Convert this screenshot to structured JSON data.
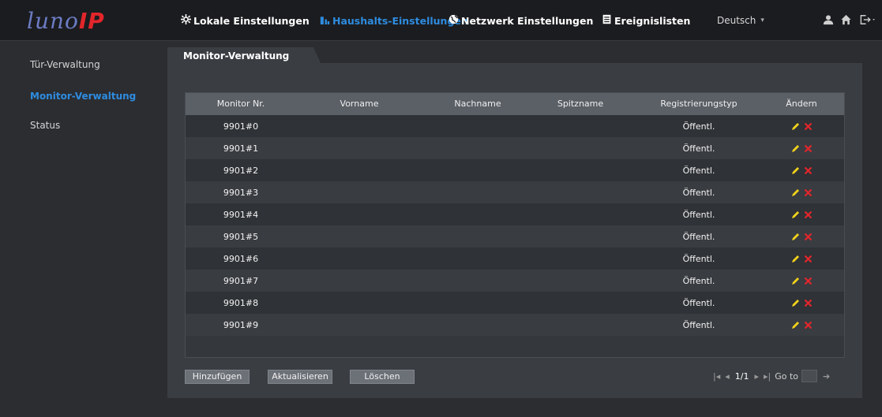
{
  "header": {
    "logo_part1": "luno",
    "logo_part2": "IP",
    "nav": [
      {
        "label": "Lokale Einstellungen",
        "icon": "gear-icon"
      },
      {
        "label": "Haushalts-Einstellungen",
        "icon": "building-icon"
      },
      {
        "label": "Netzwerk Einstellungen",
        "icon": "globe-icon"
      },
      {
        "label": "Ereignislisten",
        "icon": "list-icon"
      }
    ],
    "language": "Deutsch",
    "icons": [
      "user-icon",
      "home-icon",
      "logout-icon"
    ]
  },
  "sidebar": {
    "items": [
      {
        "label": "Tür-Verwaltung"
      },
      {
        "label": "Monitor-Verwaltung"
      },
      {
        "label": "Status"
      }
    ]
  },
  "main": {
    "tab_label": "Monitor-Verwaltung",
    "columns": [
      "Monitor Nr.",
      "Vorname",
      "Nachname",
      "Spitzname",
      "Registrierungstyp",
      "Ändern"
    ],
    "rows": [
      {
        "monitor": "9901#0",
        "vorname": "",
        "nachname": "",
        "spitzname": "",
        "typ": "Öffentl."
      },
      {
        "monitor": "9901#1",
        "vorname": "",
        "nachname": "",
        "spitzname": "",
        "typ": "Öffentl."
      },
      {
        "monitor": "9901#2",
        "vorname": "",
        "nachname": "",
        "spitzname": "",
        "typ": "Öffentl."
      },
      {
        "monitor": "9901#3",
        "vorname": "",
        "nachname": "",
        "spitzname": "",
        "typ": "Öffentl."
      },
      {
        "monitor": "9901#4",
        "vorname": "",
        "nachname": "",
        "spitzname": "",
        "typ": "Öffentl."
      },
      {
        "monitor": "9901#5",
        "vorname": "",
        "nachname": "",
        "spitzname": "",
        "typ": "Öffentl."
      },
      {
        "monitor": "9901#6",
        "vorname": "",
        "nachname": "",
        "spitzname": "",
        "typ": "Öffentl."
      },
      {
        "monitor": "9901#7",
        "vorname": "",
        "nachname": "",
        "spitzname": "",
        "typ": "Öffentl."
      },
      {
        "monitor": "9901#8",
        "vorname": "",
        "nachname": "",
        "spitzname": "",
        "typ": "Öffentl."
      },
      {
        "monitor": "9901#9",
        "vorname": "",
        "nachname": "",
        "spitzname": "",
        "typ": "Öffentl."
      }
    ],
    "buttons": {
      "add": "Hinzufügen",
      "refresh": "Aktualisieren",
      "delete": "Löschen"
    },
    "pager": {
      "page": "1/1",
      "goto_label": "Go to",
      "goto_value": ""
    }
  },
  "colors": {
    "accent": "#2e8ce0",
    "edit_icon": "#f2d21b",
    "delete_icon": "#e2262b",
    "logo_blue": "#6c7cc4",
    "logo_red": "#e2262b"
  }
}
